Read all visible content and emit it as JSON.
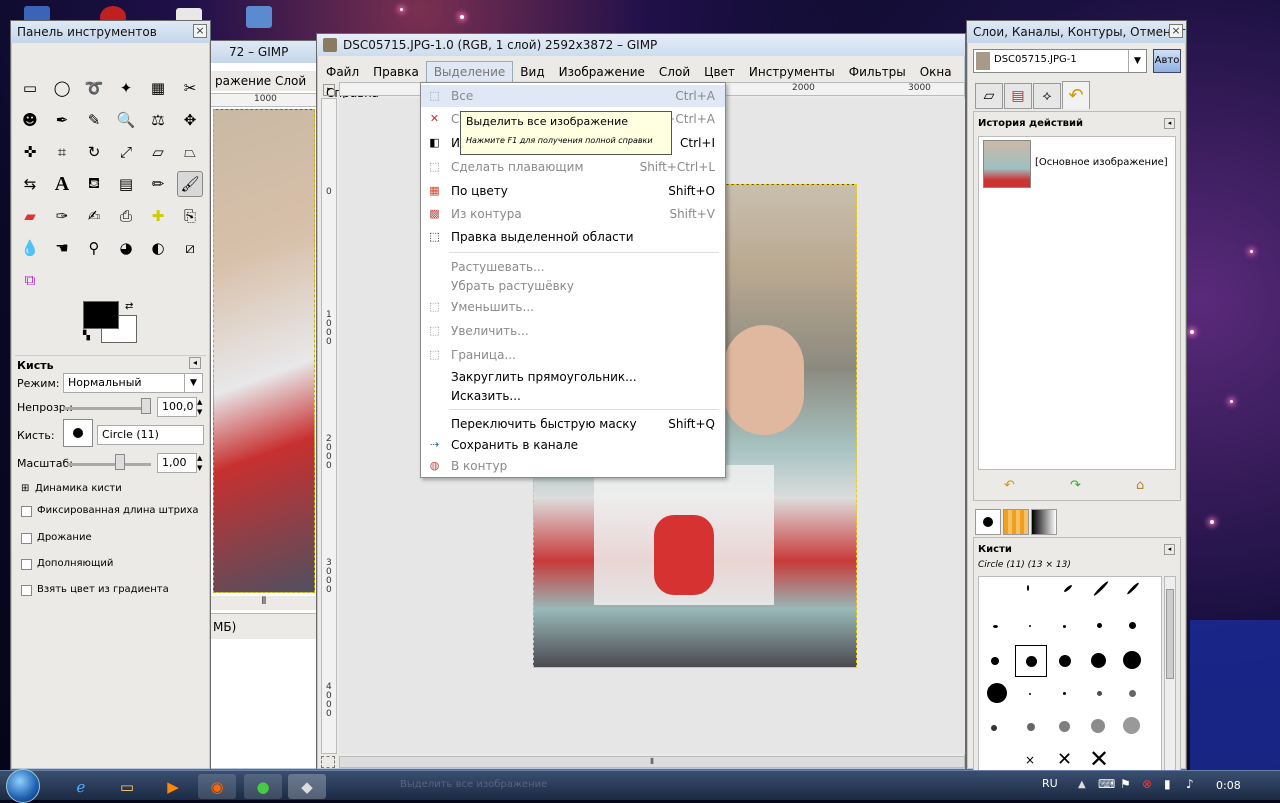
{
  "toolbox": {
    "title": "Панель инструментов",
    "close": "×",
    "tool_options_title": "Кисть",
    "mode_label": "Режим:",
    "mode_value": "Нормальный",
    "opacity_label": "Непрозр.:",
    "opacity_value": "100,0",
    "brush_label": "Кисть:",
    "brush_value": "Circle (11)",
    "scale_label": "Масштаб:",
    "scale_value": "1,00",
    "dynamics": "Динамика кисти",
    "fixed_length": "Фиксированная длина штриха",
    "jitter": "Дрожание",
    "incremental": "Дополняющий",
    "gradient_color": "Взять цвет из градиента"
  },
  "bg_window": {
    "title_fragment": "72 – GIMP",
    "menu_fragment_1": "ражение",
    "menu_fragment_2": "Слой",
    "ruler_mark": "1000",
    "status_fragment": "МБ)"
  },
  "gimp": {
    "title": "DSC05715.JPG-1.0 (RGB, 1 слой) 2592x3872 – GIMP",
    "menu": [
      "Файл",
      "Правка",
      "Выделение",
      "Вид",
      "Изображение",
      "Слой",
      "Цвет",
      "Инструменты",
      "Фильтры",
      "Окна",
      "Справка"
    ],
    "ruler_marks": [
      "2000",
      "3000"
    ],
    "vruler_marks": [
      "0",
      "1000",
      "2000",
      "3000",
      "4000"
    ]
  },
  "select_menu": {
    "items": [
      {
        "label": "Все",
        "shortcut": "Ctrl+A",
        "disabled": true
      },
      {
        "label": "Снять",
        "shortcut": "Shift+Ctrl+A",
        "disabled": true
      },
      {
        "label": "Инвертировать",
        "shortcut": "Ctrl+I",
        "disabled": false
      },
      {
        "label": "Сделать плавающим",
        "shortcut": "Shift+Ctrl+L",
        "disabled": true
      },
      {
        "label": "По цвету",
        "shortcut": "Shift+O",
        "disabled": false
      },
      {
        "label": "Из контура",
        "shortcut": "Shift+V",
        "disabled": true
      },
      {
        "label": "Правка выделенной области",
        "shortcut": "",
        "disabled": false
      },
      {
        "label": "Растушевать...",
        "shortcut": "",
        "disabled": true
      },
      {
        "label": "Убрать растушёвку",
        "shortcut": "",
        "disabled": true
      },
      {
        "label": "Уменьшить...",
        "shortcut": "",
        "disabled": true
      },
      {
        "label": "Увеличить...",
        "shortcut": "",
        "disabled": true
      },
      {
        "label": "Граница...",
        "shortcut": "",
        "disabled": true
      },
      {
        "label": "Закруглить прямоугольник...",
        "shortcut": "",
        "disabled": false
      },
      {
        "label": "Исказить...",
        "shortcut": "",
        "disabled": false
      },
      {
        "label": "Переключить быструю маску",
        "shortcut": "Shift+Q",
        "disabled": false
      },
      {
        "label": "Сохранить в канале",
        "shortcut": "",
        "disabled": false
      },
      {
        "label": "В контур",
        "shortcut": "",
        "disabled": true
      }
    ]
  },
  "tooltip": {
    "title": "Выделить все изображение",
    "hint": "Нажмите F1 для получения полной справки"
  },
  "dock": {
    "title": "Слои, Каналы, Контуры, Отменит...",
    "image_name": "DSC05715.JPG-1",
    "auto_button": "Авто",
    "history_title": "История действий",
    "history_item": "[Основное изображение]",
    "brushes_title": "Кисти",
    "brush_info": "Circle (11) (13 × 13)"
  },
  "taskbar": {
    "lang": "RU",
    "clock": "0:08",
    "faded_task": "Выделить все изображение"
  },
  "colors": {
    "accent": "#dfe8f4",
    "tooltip_bg": "#ffffe1",
    "selection_border": "#f0d000"
  }
}
